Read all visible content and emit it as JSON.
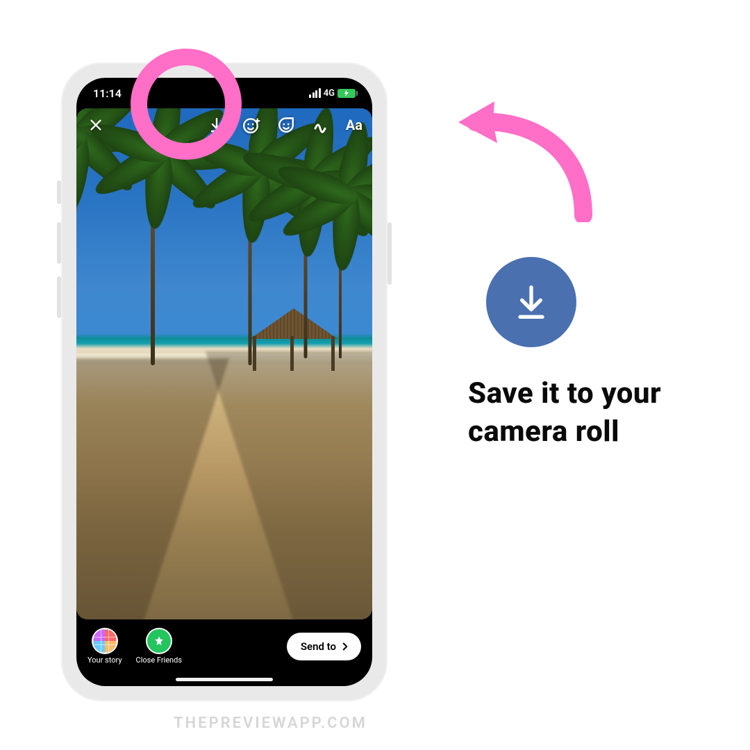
{
  "status": {
    "time": "11:14",
    "network": "4G"
  },
  "story": {
    "tools": {
      "text_label": "Aa"
    },
    "destinations": {
      "your_story": "Your story",
      "close_friends": "Close Friends"
    },
    "send_label": "Send to"
  },
  "annotation": {
    "text": "Save it to your camera roll"
  },
  "watermark": "THEPREVIEWAPP.COM",
  "colors": {
    "highlight": "#ff6ec7",
    "callout_bg": "#4a70b0"
  }
}
